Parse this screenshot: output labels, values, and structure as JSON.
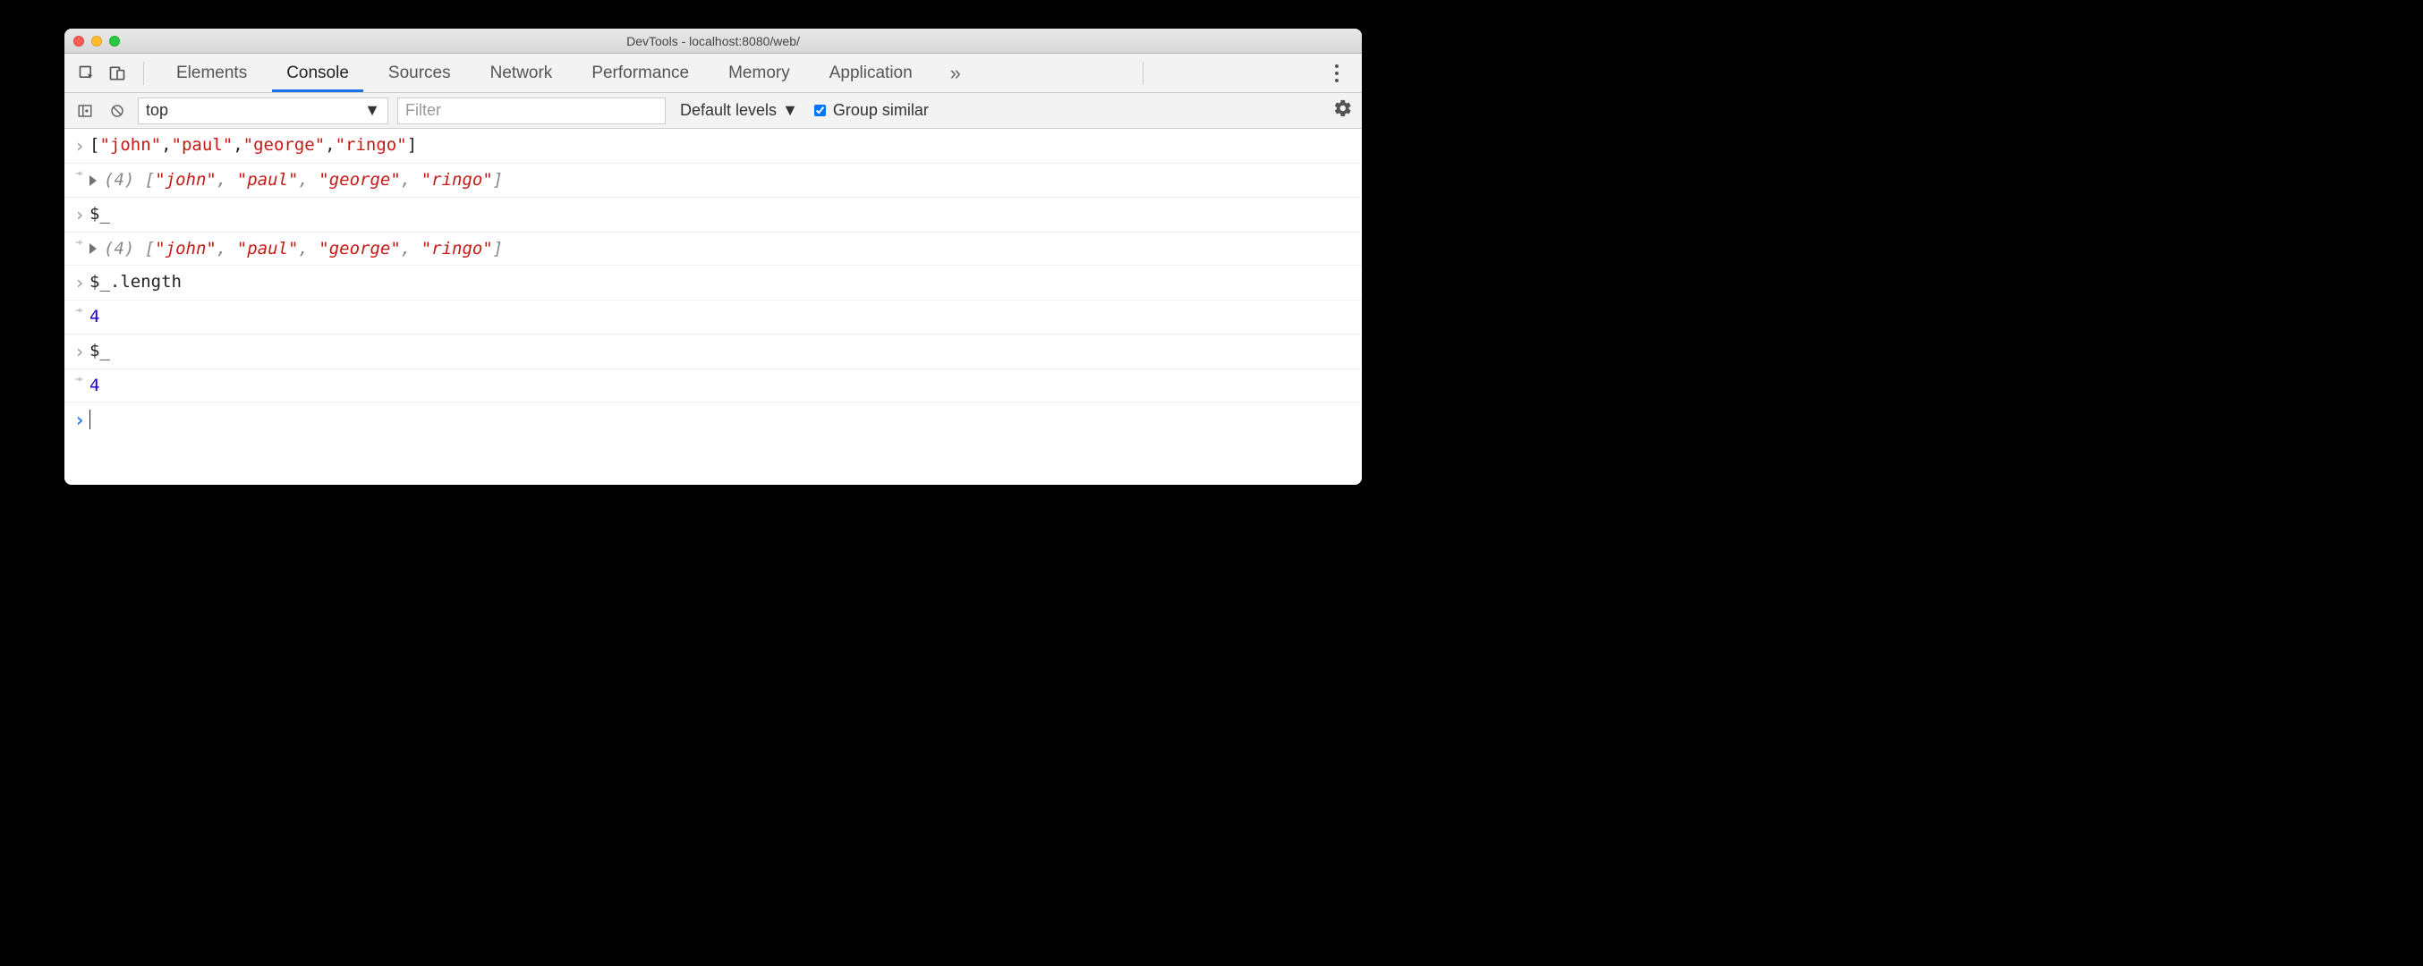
{
  "window": {
    "title": "DevTools - localhost:8080/web/"
  },
  "tabs": {
    "items": [
      "Elements",
      "Console",
      "Sources",
      "Network",
      "Performance",
      "Memory",
      "Application"
    ],
    "active_index": 1,
    "overflow_glyph": "»"
  },
  "filterbar": {
    "context": "top",
    "filter_placeholder": "Filter",
    "levels_label": "Default levels",
    "group_similar_label": "Group similar",
    "group_similar_checked": true
  },
  "console": {
    "rows": [
      {
        "kind": "input",
        "tokens": [
          {
            "t": "[",
            "c": "plain"
          },
          {
            "t": "\"john\"",
            "c": "str"
          },
          {
            "t": ",",
            "c": "plain"
          },
          {
            "t": "\"paul\"",
            "c": "str"
          },
          {
            "t": ",",
            "c": "plain"
          },
          {
            "t": "\"george\"",
            "c": "str"
          },
          {
            "t": ",",
            "c": "plain"
          },
          {
            "t": "\"ringo\"",
            "c": "str"
          },
          {
            "t": "]",
            "c": "plain"
          }
        ]
      },
      {
        "kind": "output-array",
        "count": "(4)",
        "tokens": [
          {
            "t": "[",
            "c": "arr-italic"
          },
          {
            "t": "\"john\"",
            "c": "str"
          },
          {
            "t": ", ",
            "c": "arr-italic"
          },
          {
            "t": "\"paul\"",
            "c": "str"
          },
          {
            "t": ", ",
            "c": "arr-italic"
          },
          {
            "t": "\"george\"",
            "c": "str"
          },
          {
            "t": ", ",
            "c": "arr-italic"
          },
          {
            "t": "\"ringo\"",
            "c": "str"
          },
          {
            "t": "]",
            "c": "arr-italic"
          }
        ],
        "italic": true
      },
      {
        "kind": "input",
        "tokens": [
          {
            "t": "$_",
            "c": "plain"
          }
        ]
      },
      {
        "kind": "output-array",
        "count": "(4)",
        "tokens": [
          {
            "t": "[",
            "c": "arr-italic"
          },
          {
            "t": "\"john\"",
            "c": "str"
          },
          {
            "t": ", ",
            "c": "arr-italic"
          },
          {
            "t": "\"paul\"",
            "c": "str"
          },
          {
            "t": ", ",
            "c": "arr-italic"
          },
          {
            "t": "\"george\"",
            "c": "str"
          },
          {
            "t": ", ",
            "c": "arr-italic"
          },
          {
            "t": "\"ringo\"",
            "c": "str"
          },
          {
            "t": "]",
            "c": "arr-italic"
          }
        ],
        "italic": true
      },
      {
        "kind": "input",
        "tokens": [
          {
            "t": "$_.length",
            "c": "plain"
          }
        ]
      },
      {
        "kind": "output",
        "tokens": [
          {
            "t": "4",
            "c": "num"
          }
        ]
      },
      {
        "kind": "input",
        "tokens": [
          {
            "t": "$_",
            "c": "plain"
          }
        ]
      },
      {
        "kind": "output",
        "tokens": [
          {
            "t": "4",
            "c": "num"
          }
        ]
      },
      {
        "kind": "prompt"
      }
    ]
  }
}
